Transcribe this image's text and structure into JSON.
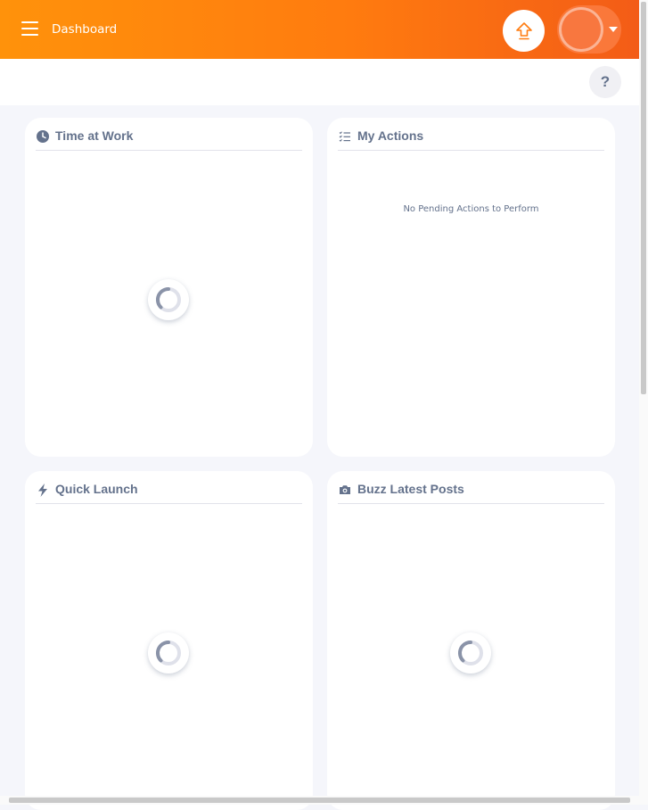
{
  "header": {
    "title": "Dashboard",
    "menu_icon": "hamburger-icon",
    "upgrade_icon": "upgrade-arrow-icon",
    "accent_color": "#ff7b0f",
    "user_dropdown_icon": "chevron-down-icon"
  },
  "subbar": {
    "help_label": "?"
  },
  "widgets": [
    {
      "title": "Time at Work",
      "icon": "clock-icon",
      "state": "loading"
    },
    {
      "title": "My Actions",
      "icon": "list-icon",
      "state": "empty",
      "empty_text": "No Pending Actions to Perform"
    },
    {
      "title": "Quick Launch",
      "icon": "lightning-icon",
      "state": "loading"
    },
    {
      "title": "Buzz Latest Posts",
      "icon": "camera-icon",
      "state": "loading"
    }
  ]
}
